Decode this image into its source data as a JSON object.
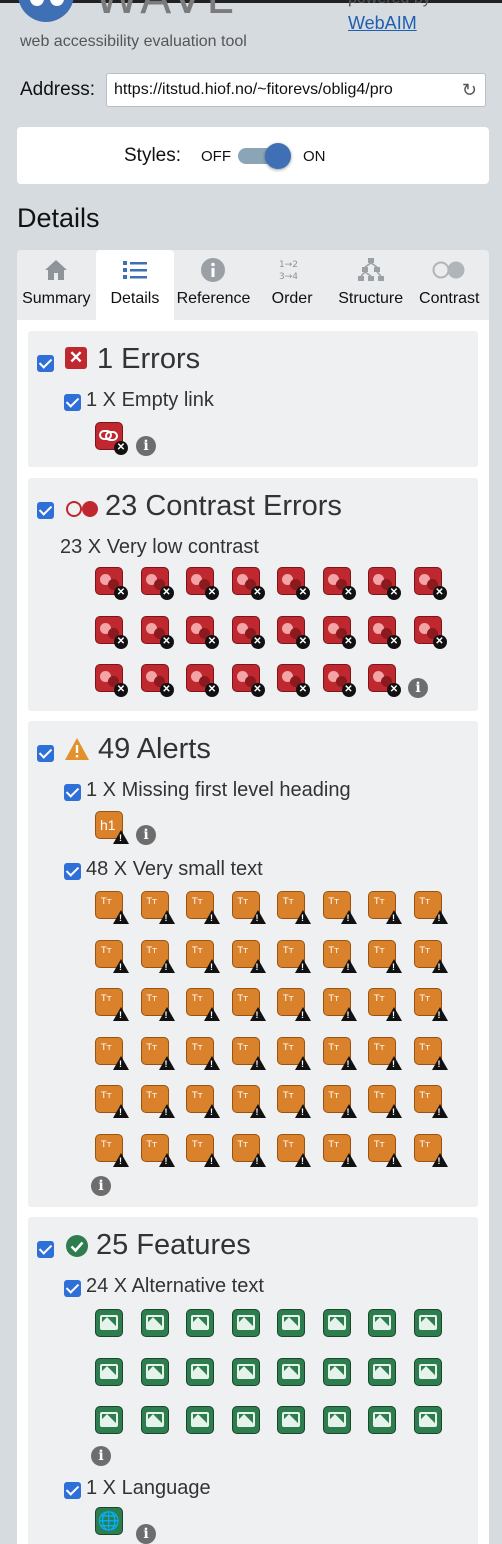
{
  "header": {
    "logo_word": "WAVE",
    "tagline": "web accessibility evaluation tool",
    "powered_by": "powered by",
    "webaim_link": "WebAIM"
  },
  "address": {
    "label": "Address:",
    "value": "https://itstud.hiof.no/~fitorevs/oblig4/pro",
    "reload_icon": "reload-icon"
  },
  "styles": {
    "label": "Styles:",
    "off": "OFF",
    "on": "ON",
    "state": "on"
  },
  "page_title": "Details",
  "tabs": [
    {
      "label": "Summary",
      "icon": "home-icon",
      "active": false
    },
    {
      "label": "Details",
      "icon": "list-icon",
      "active": true
    },
    {
      "label": "Reference",
      "icon": "info-icon",
      "active": false
    },
    {
      "label": "Order",
      "icon": "order-icon",
      "active": false
    },
    {
      "label": "Structure",
      "icon": "structure-icon",
      "active": false
    },
    {
      "label": "Contrast",
      "icon": "contrast-icon",
      "active": false
    }
  ],
  "sections": {
    "errors": {
      "title": "1 Errors",
      "items": [
        {
          "label": "1 X Empty link",
          "count": 1
        }
      ]
    },
    "contrast": {
      "title": "23 Contrast Errors",
      "items": [
        {
          "label": "23 X Very low contrast",
          "count": 23
        }
      ]
    },
    "alerts": {
      "title": "49 Alerts",
      "items": [
        {
          "label": "1 X Missing first level heading",
          "count": 1,
          "icon_text": "h1"
        },
        {
          "label": "48 X Very small text",
          "count": 48,
          "icon_text": "Tт"
        }
      ]
    },
    "features": {
      "title": "25 Features",
      "items": [
        {
          "label": "24 X Alternative text",
          "count": 24
        },
        {
          "label": "1 X Language",
          "count": 1
        }
      ]
    }
  },
  "colors": {
    "error": "#c0282f",
    "alert": "#d9822b",
    "feature": "#2e7d4f",
    "accent": "#3f6fb4",
    "checkbox": "#2f6fd8"
  }
}
